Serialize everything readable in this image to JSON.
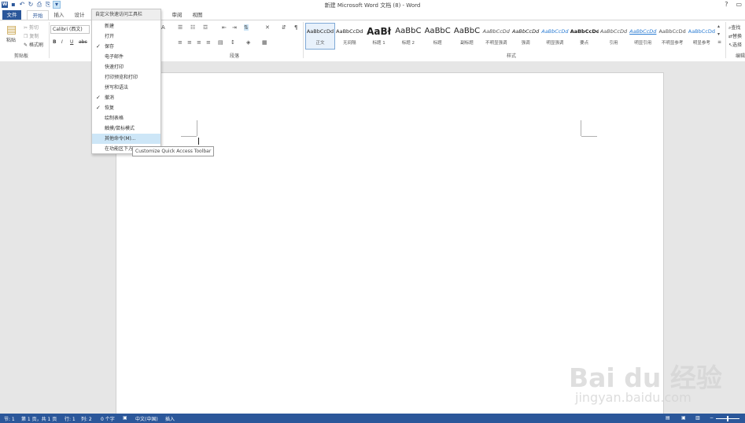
{
  "window": {
    "title": "新建 Microsoft Word 文档 (8) - Word",
    "help_label": "?",
    "restore_label": "▭"
  },
  "qat": {
    "icons": [
      "word-app-icon",
      "save-icon",
      "undo-icon",
      "redo-icon",
      "print-preview-icon",
      "quick-print-icon",
      "customize-qat-icon"
    ]
  },
  "tabs": [
    {
      "label": "文件"
    },
    {
      "label": "开始"
    },
    {
      "label": "插入"
    },
    {
      "label": "设计"
    },
    {
      "label": "审阅"
    },
    {
      "label": "视图"
    }
  ],
  "ribbon": {
    "clipboard": {
      "paste": "粘贴",
      "cut": "剪切",
      "copy": "复制",
      "format_painter": "格式刷",
      "group_label": "剪贴板"
    },
    "font": {
      "font_name": "Calibri (西文)",
      "bold": "B",
      "italic": "I",
      "underline": "U",
      "strike": "abc"
    },
    "paragraph": {
      "group_label": "段落"
    },
    "styles": {
      "group_label": "样式",
      "items": [
        {
          "preview": "AaBbCcDd",
          "name": "正文",
          "sel": true
        },
        {
          "preview": "AaBbCcDd",
          "name": "无间隔"
        },
        {
          "preview": "AaBł",
          "name": "标题 1"
        },
        {
          "preview": "AaBbC",
          "name": "标题 2"
        },
        {
          "preview": "AaBbC",
          "name": "标题"
        },
        {
          "preview": "AaBbC",
          "name": "副标题"
        },
        {
          "preview": "AaBbCcDd",
          "name": "不明显强调"
        },
        {
          "preview": "AaBbCcDd",
          "name": "强调"
        },
        {
          "preview": "AaBbCcDd",
          "name": "明显强调"
        },
        {
          "preview": "AaBbCcDd",
          "name": "要点"
        },
        {
          "preview": "AaBbCcDd",
          "name": "引用"
        },
        {
          "preview": "AaBbCcDd",
          "name": "明显引用"
        },
        {
          "preview": "AaBbCcDd",
          "name": "不明显参考"
        },
        {
          "preview": "AaBbCcDd",
          "name": "明显参考"
        }
      ]
    },
    "editing": {
      "find": "查找",
      "replace": "替换",
      "select": "选择",
      "group_label": "编辑"
    }
  },
  "qat_menu": {
    "header": "自定义快速访问工具栏",
    "items": [
      {
        "label": "新建",
        "checked": false
      },
      {
        "label": "打开",
        "checked": false
      },
      {
        "label": "保存",
        "checked": true
      },
      {
        "label": "电子邮件",
        "checked": false
      },
      {
        "label": "快速打印",
        "checked": false
      },
      {
        "label": "打印预览和打印",
        "checked": false
      },
      {
        "label": "拼写和语法",
        "checked": false
      },
      {
        "label": "撤消",
        "checked": true
      },
      {
        "label": "恢复",
        "checked": true
      },
      {
        "label": "绘制表格",
        "checked": false
      },
      {
        "label": "触摸/鼠标模式",
        "checked": false
      },
      {
        "label": "其他命令(M)...",
        "checked": false,
        "highlight": true
      },
      {
        "label": "在功能区下方显示",
        "checked": false
      }
    ],
    "tooltip": "Customize Quick Access Toolbar"
  },
  "statusbar": {
    "section": "节: 1",
    "page": "第 1 页，共 1 页",
    "line": "行: 1",
    "column": "列: 2",
    "words": "0 个字",
    "language": "中文(中国)",
    "mode": "插入"
  },
  "watermark": {
    "line1": "Bai du 经验",
    "line2": "jingyan.baidu.com"
  },
  "colors": {
    "accent": "#2b579a",
    "menu_highlight": "#cde6f7"
  }
}
